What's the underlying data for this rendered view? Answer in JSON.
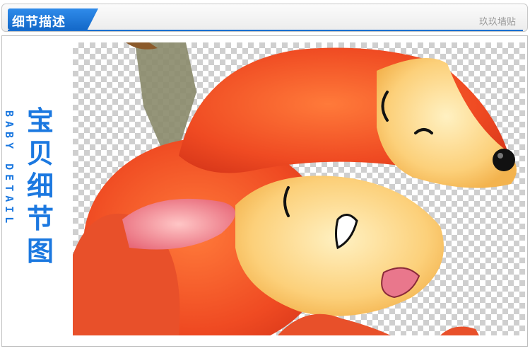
{
  "header": {
    "title": "细节描述",
    "brand": "玖玖墙贴"
  },
  "side": {
    "english": "BABY DETAIL",
    "chinese": [
      "宝",
      "贝",
      "细",
      "节",
      "图"
    ]
  },
  "image": {
    "subject": "cartoon-fox-illustration"
  },
  "colors": {
    "accent": "#1b78e0",
    "fox_orange": "#f0552a",
    "fox_cream": "#fcd07a"
  }
}
